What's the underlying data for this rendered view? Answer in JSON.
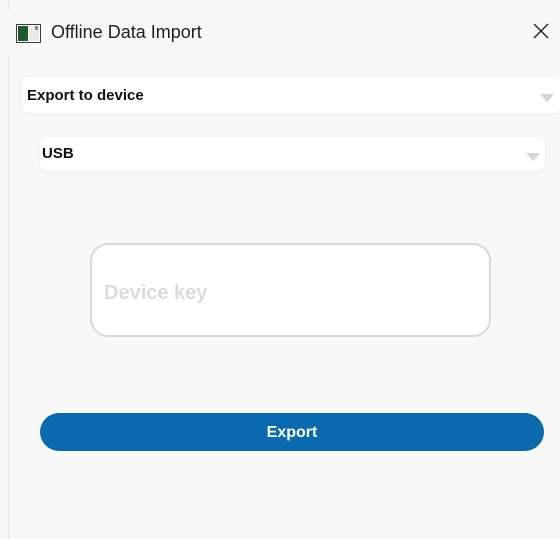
{
  "window": {
    "title": "Offline Data Import",
    "app_icon": "app-window-icon",
    "close_icon": "close-icon"
  },
  "form": {
    "mode_select": {
      "value": "Export to device"
    },
    "transport_select": {
      "value": "USB"
    },
    "device_key": {
      "placeholder": "Device key",
      "value": ""
    },
    "export_button": {
      "label": "Export"
    }
  },
  "colors": {
    "primary_button": "#0b6aaf",
    "window_background": "#f8f8f8",
    "input_border": "#d9d9d9",
    "placeholder_text": "#dcdcdc"
  }
}
